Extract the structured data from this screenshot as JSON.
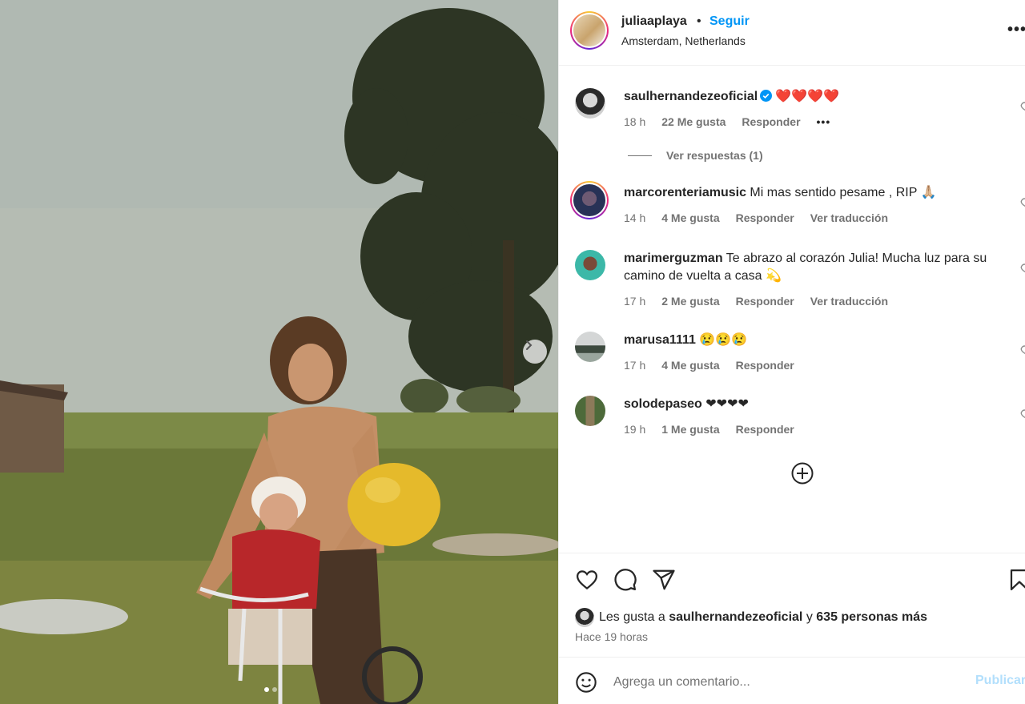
{
  "colors": {
    "accent": "#0095f6",
    "text": "#262626",
    "muted": "#737373",
    "divider": "#efefef",
    "post_disabled": "#b2dffc"
  },
  "carousel": {
    "slide_count": 2,
    "active_slide": 1,
    "next_icon": "chevron-right-icon"
  },
  "header": {
    "username": "juliaaplaya",
    "separator": "•",
    "follow_label": "Seguir",
    "location": "Amsterdam, Netherlands",
    "more_icon": "more-options-icon",
    "more_label": "•••"
  },
  "comments": [
    {
      "username": "saulhernandezeoficial",
      "verified": true,
      "text": "❤️❤️❤️❤️",
      "time": "18 h",
      "likes": "22 Me gusta",
      "reply": "Responder",
      "options": "•••",
      "view_replies": "Ver respuestas (1)"
    },
    {
      "username": "marcorenteriamusic",
      "text": "Mi mas sentido pesame , RIP 🙏🏼",
      "time": "14 h",
      "likes": "4 Me gusta",
      "reply": "Responder",
      "translate": "Ver traducción"
    },
    {
      "username": "marimerguzman",
      "text": "Te abrazo al corazón Julia! Mucha luz para su camino de vuelta a casa 💫",
      "time": "17 h",
      "likes": "2 Me gusta",
      "reply": "Responder",
      "translate": "Ver traducción"
    },
    {
      "username": "marusa1111",
      "text": "😢😢😢",
      "time": "17 h",
      "likes": "4 Me gusta",
      "reply": "Responder"
    },
    {
      "username": "solodepaseo",
      "text": "❤❤❤❤",
      "time": "19 h",
      "likes": "1 Me gusta",
      "reply": "Responder"
    }
  ],
  "load_more_icon": "plus-circle-icon",
  "actions": {
    "icons": [
      "heart-icon",
      "comment-icon",
      "share-icon",
      "bookmark-icon"
    ],
    "likes_prefix": "Les gusta a",
    "likes_user": "saulhernandezeoficial",
    "likes_joiner": "y",
    "likes_rest": "635 personas más",
    "time": "Hace 19 horas"
  },
  "composer": {
    "emoji_icon": "emoji-icon",
    "placeholder": "Agrega un comentario...",
    "post_label": "Publicar"
  }
}
